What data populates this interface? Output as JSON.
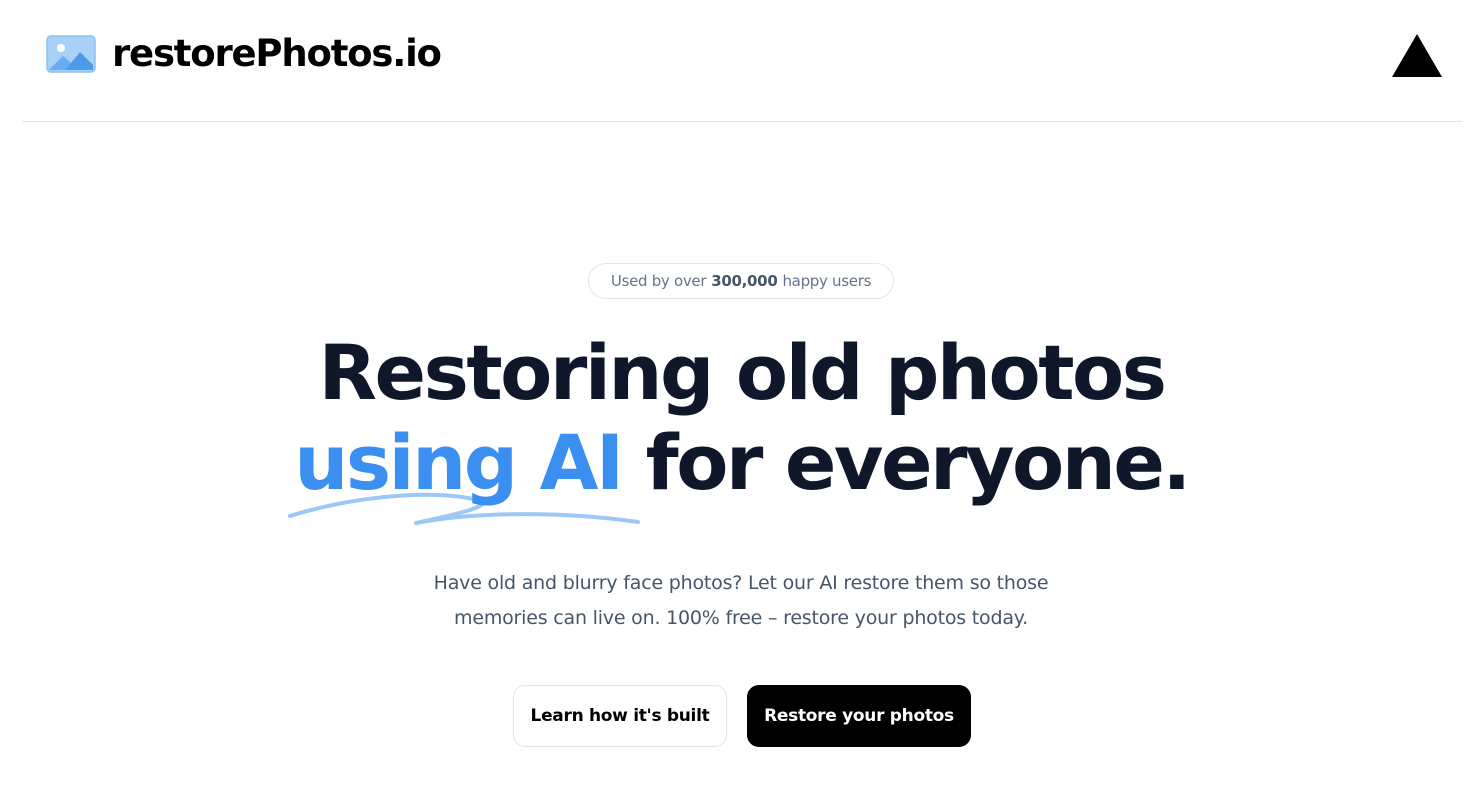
{
  "header": {
    "brand": "restorePhotos.io",
    "logo_icon": "photo-icon",
    "vercel_icon": "vercel-triangle-icon"
  },
  "hero": {
    "badge": {
      "prefix": "Used by over",
      "count": "300,000",
      "suffix": "happy users"
    },
    "headline": {
      "line1": "Restoring old photos",
      "accent": "using AI",
      "rest": "for everyone."
    },
    "subtitle": "Have old and blurry face photos? Let our AI restore them so those memories can live on. 100% free – restore your photos today.",
    "buttons": {
      "secondary": "Learn how it's built",
      "primary": "Restore your photos"
    }
  },
  "colors": {
    "accent": "#3b8ff0",
    "heading": "#0f172a",
    "body_text": "#475569",
    "primary_button": "#000000",
    "border": "#e2e5ea"
  }
}
